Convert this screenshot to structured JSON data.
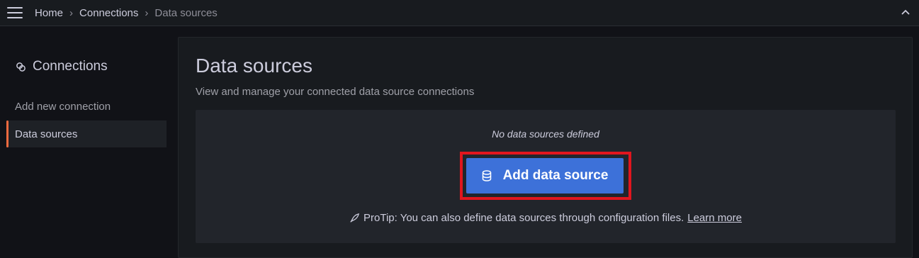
{
  "header": {
    "breadcrumbs": [
      "Home",
      "Connections",
      "Data sources"
    ]
  },
  "sidebar": {
    "title": "Connections",
    "items": [
      {
        "label": "Add new connection",
        "active": false
      },
      {
        "label": "Data sources",
        "active": true
      }
    ]
  },
  "main": {
    "title": "Data sources",
    "subtitle": "View and manage your connected data source connections",
    "empty_state": {
      "message": "No data sources defined",
      "button_label": "Add data source",
      "protip": "ProTip: You can also define data sources through configuration files.",
      "link_label": "Learn more"
    }
  },
  "colors": {
    "accent_orange": "#f06a3f",
    "primary_button": "#3d71d9",
    "highlight_box": "#e1161e"
  },
  "icons": {
    "menu": "hamburger-icon",
    "collapse": "chevron-up-icon",
    "connections": "link-icon",
    "database": "database-icon",
    "rocket": "rocket-icon"
  }
}
